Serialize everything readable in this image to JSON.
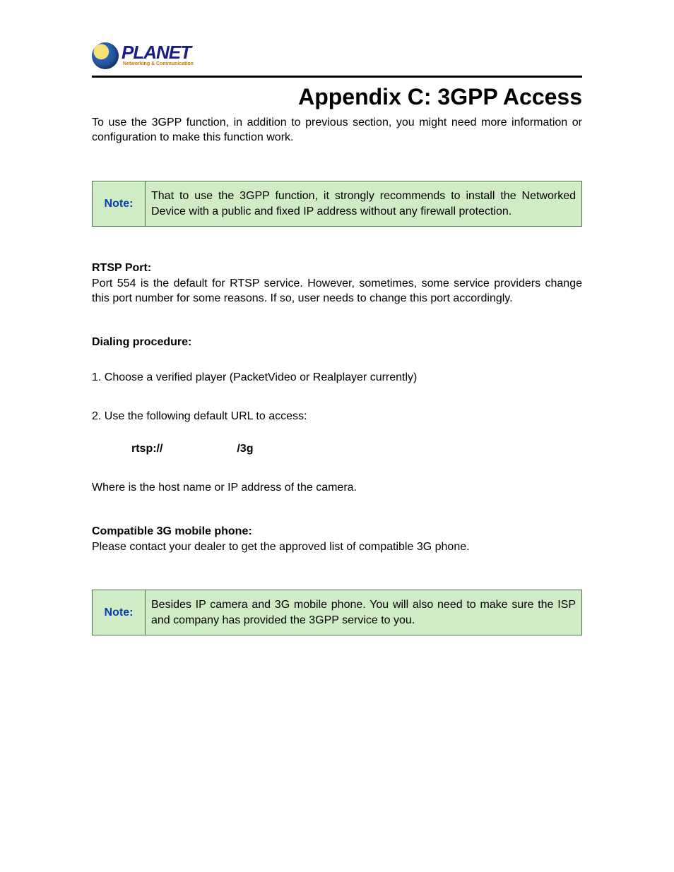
{
  "logo": {
    "main": "PLANET",
    "sub": "Networking & Communication"
  },
  "title": "Appendix C: 3GPP Access",
  "intro": "To use the 3GPP function, in addition to previous section, you might need more information or configuration to make this function work.",
  "note1": {
    "label": "Note:",
    "text": "That to use the 3GPP function, it strongly recommends to install the Networked Device with a public and fixed IP address without any firewall protection."
  },
  "rtsp": {
    "heading": "RTSP Port:",
    "text": "Port 554 is the default for RTSP service. However, sometimes, some service providers change this port number for some reasons. If so, user needs to change this port accordingly."
  },
  "dialing": {
    "heading": "Dialing procedure:",
    "step1": "1. Choose a verified player (PacketVideo or Realplayer currently)",
    "step2": "2. Use the following default URL to access:",
    "url_prefix": "rtsp://",
    "url_suffix": "/3g",
    "where": "Where        is the host name or IP address of the camera."
  },
  "compat": {
    "heading": "Compatible 3G mobile phone:",
    "text": "Please contact your dealer to get the approved list of compatible 3G phone."
  },
  "note2": {
    "label": "Note:",
    "text": "Besides IP camera and 3G mobile phone. You will also need to make sure the ISP and company has provided the 3GPP service to you."
  }
}
